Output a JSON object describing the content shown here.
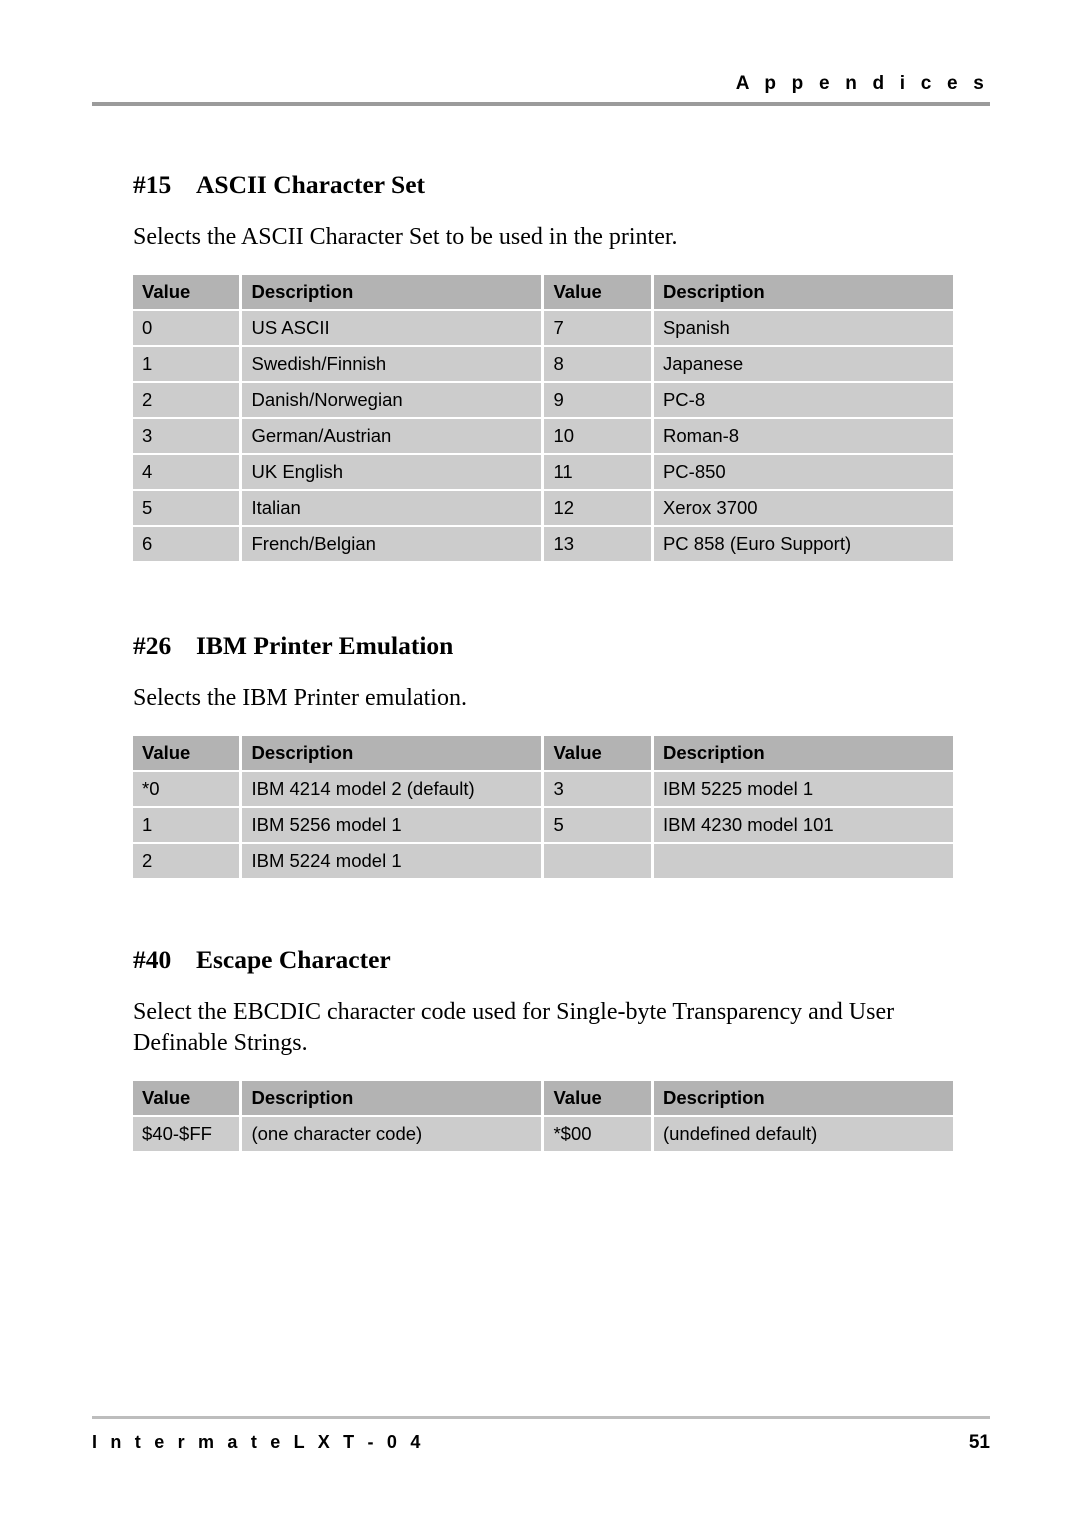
{
  "header": {
    "title": "A p p e n d i c e s"
  },
  "footer": {
    "document": "I n t e r m a t e   L X   T - 0 4",
    "page_number": "51"
  },
  "table_headers": {
    "value": "Value",
    "description": "Description"
  },
  "sections": [
    {
      "number": "#15",
      "title": "ASCII Character Set",
      "body": "Selects the ASCII Character Set to be used in the printer.",
      "rows": [
        {
          "v1": "0",
          "d1": "US ASCII",
          "v2": "7",
          "d2": "Spanish"
        },
        {
          "v1": "1",
          "d1": "Swedish/Finnish",
          "v2": "8",
          "d2": "Japanese"
        },
        {
          "v1": "2",
          "d1": "Danish/Norwegian",
          "v2": "9",
          "d2": "PC-8"
        },
        {
          "v1": "3",
          "d1": "German/Austrian",
          "v2": "10",
          "d2": "Roman-8"
        },
        {
          "v1": "4",
          "d1": "UK English",
          "v2": "11",
          "d2": "PC-850"
        },
        {
          "v1": "5",
          "d1": "Italian",
          "v2": "12",
          "d2": "Xerox 3700"
        },
        {
          "v1": "6",
          "d1": "French/Belgian",
          "v2": "13",
          "d2": "PC 858 (Euro Support)"
        }
      ]
    },
    {
      "number": "#26",
      "title": "IBM Printer Emulation",
      "body": "Selects the IBM Printer emulation.",
      "rows": [
        {
          "v1": "*0",
          "d1": "IBM 4214 model 2 (default)",
          "v2": "3",
          "d2": "IBM 5225 model 1"
        },
        {
          "v1": "1",
          "d1": "IBM 5256 model 1",
          "v2": "5",
          "d2": "IBM 4230 model 101"
        },
        {
          "v1": "2",
          "d1": "IBM 5224 model 1",
          "v2": "",
          "d2": ""
        }
      ]
    },
    {
      "number": "#40",
      "title": "Escape Character",
      "body": "Select the EBCDIC character code used for Single-byte Transparency and User Definable Strings.",
      "rows": [
        {
          "v1": "$40-$FF",
          "d1": "(one character code)",
          "v2": "*$00",
          "d2": "(undefined default)"
        }
      ]
    }
  ]
}
